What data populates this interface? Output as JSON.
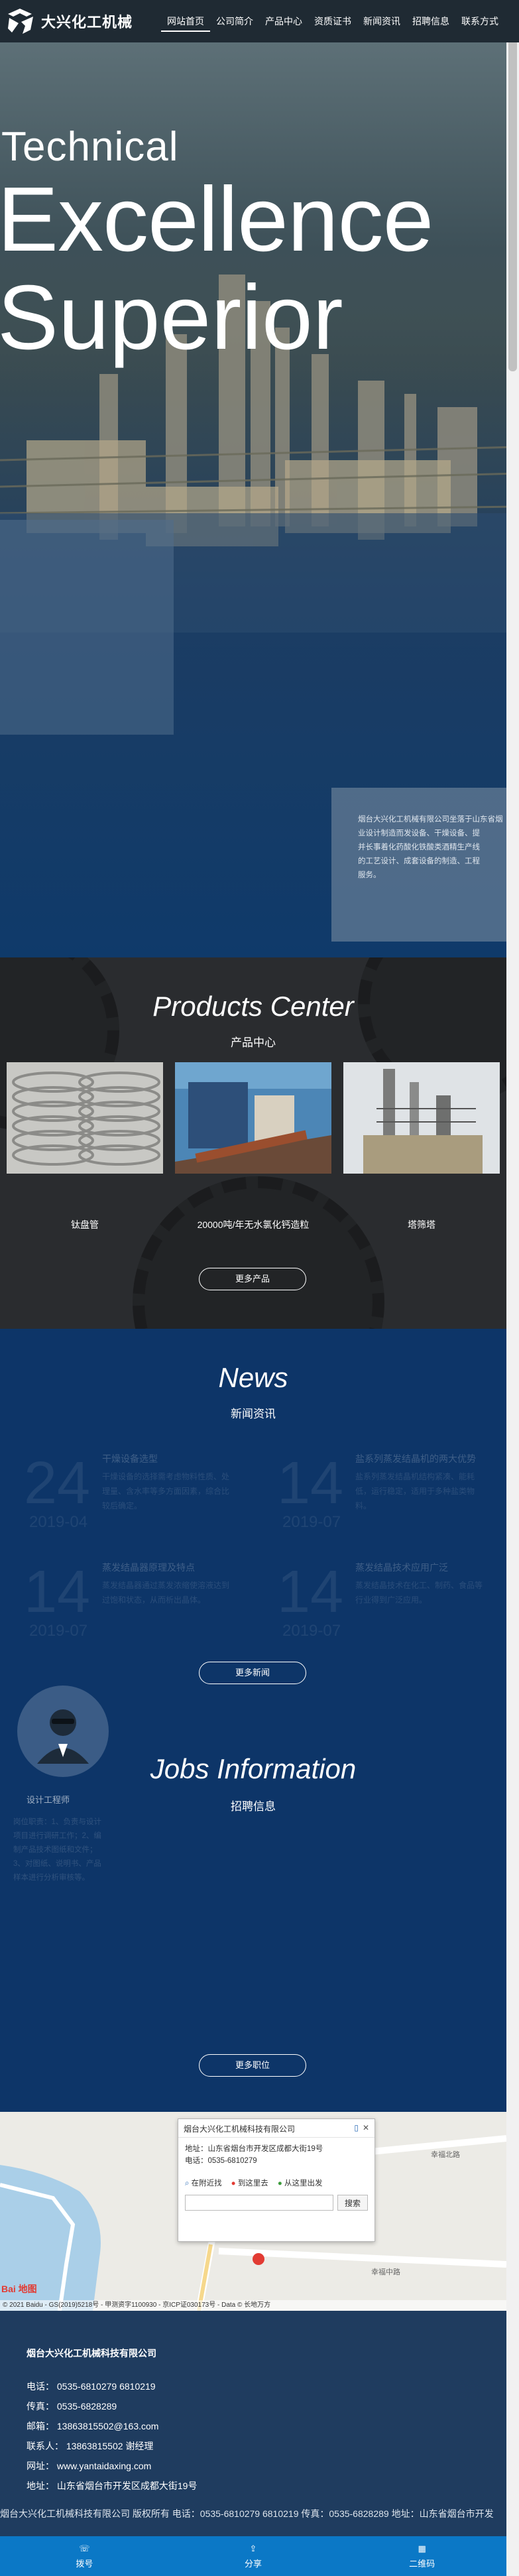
{
  "header": {
    "logo_text": "大兴化工机械",
    "nav": [
      "网站首页",
      "公司简介",
      "产品中心",
      "资质证书",
      "新闻资讯",
      "招聘信息",
      "联系方式"
    ]
  },
  "hero": {
    "line1": "Technical",
    "line2": "Excellence",
    "line3": "Superior",
    "intro_lines": [
      "烟台大兴化工机械有限公司坐落于山东省烟",
      "业设计制造而发设备、干燥设备、提",
      "并长事着化药酸化铁酸类酒精生产线",
      "的工艺设计、成套设备的制造、工程",
      "服务。"
    ]
  },
  "products": {
    "title": "Products Center",
    "subtitle": "产品中心",
    "items": [
      {
        "label": "钛盘管"
      },
      {
        "label": "20000吨/年无水氯化钙造粒"
      },
      {
        "label": "塔筛塔"
      }
    ],
    "more": "更多产品"
  },
  "news": {
    "title": "News",
    "subtitle": "新闻资讯",
    "items": [
      {
        "day": "24",
        "ym": "2019-04",
        "title": "干燥设备选型",
        "desc": "干燥设备的选择需考虑物料性质、处理量、含水率等多方面因素，综合比较后确定。"
      },
      {
        "day": "14",
        "ym": "2019-07",
        "title": "盐系列蒸发结晶机的两大优势",
        "desc": "盐系列蒸发结晶机结构紧凑、能耗低，运行稳定，适用于多种盐类物料。"
      },
      {
        "day": "14",
        "ym": "2019-07",
        "title": "蒸发结晶器原理及特点",
        "desc": "蒸发结晶器通过蒸发浓缩使溶液达到过饱和状态，从而析出晶体。"
      },
      {
        "day": "14",
        "ym": "2019-07",
        "title": "蒸发结晶技术应用广泛",
        "desc": "蒸发结晶技术在化工、制药、食品等行业得到广泛应用。"
      }
    ],
    "more": "更多新闻"
  },
  "jobs": {
    "title": "Jobs Information",
    "subtitle": "招聘信息",
    "role": "设计工程师",
    "desc": "岗位职责：1、负责与设计项目进行调研工作；2、编制产品技术图纸和文件；3、对图纸、说明书、产品样本进行分析审核等。",
    "more": "更多职位"
  },
  "map": {
    "company": "烟台大兴化工机械科技有限公司",
    "address": "地址：山东省烟台市开发区成都大街19号",
    "phone": "电话：0535-6810279",
    "actions": [
      "在附近找",
      "到这里去",
      "从这里出发"
    ],
    "search_button": "搜索",
    "footer": "© 2021 Baidu - GS(2019)5218号 - 甲测资字1100930 - 京ICP证030173号 - Data © 长地万方",
    "road_labels": [
      "幸福北路",
      "幸福中路"
    ],
    "brand": "Bai 地图"
  },
  "contact": {
    "title": "烟台大兴化工机械科技有限公司",
    "tel": "电话：  0535-6810279 6810219",
    "fax": "传真：  0535-6828289",
    "email": "邮箱：  13863815502@163.com",
    "person": "联系人：  13863815502 谢经理",
    "website": "网址：  www.yantaidaxing.com",
    "address": "地址：  山东省烟台市开发区成都大街19号",
    "copyright": "烟台大兴化工机械科技有限公司 版权所有 电话：0535-6810279 6810219 传真：0535-6828289 地址：山东省烟台市开发"
  },
  "bottom_bar": [
    {
      "label": "拨号",
      "icon": "phone-icon"
    },
    {
      "label": "分享",
      "icon": "share-icon"
    },
    {
      "label": "二维码",
      "icon": "qrcode-icon"
    }
  ]
}
